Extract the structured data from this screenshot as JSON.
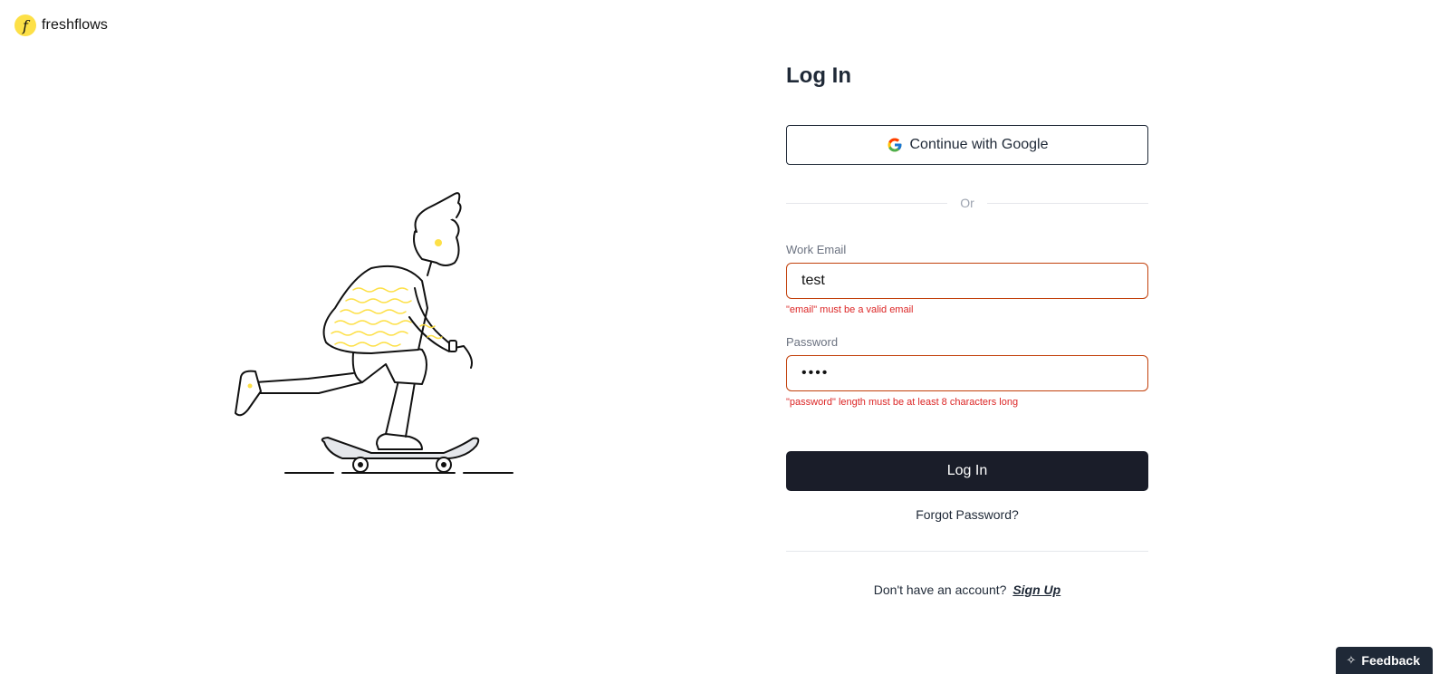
{
  "brand": {
    "logo_letter": "f",
    "name": "freshflows"
  },
  "illustration": {
    "icon": "skateboarder-illustration"
  },
  "login": {
    "title": "Log In",
    "google_label": "Continue with Google",
    "divider_label": "Or",
    "email": {
      "label": "Work Email",
      "value": "test",
      "error": "\"email\" must be a valid email"
    },
    "password": {
      "label": "Password",
      "masked_value": "••••",
      "error": "\"password\" length must be at least 8 characters long"
    },
    "submit_label": "Log In",
    "forgot_label": "Forgot Password?",
    "signup_prompt": "Don't have an account?",
    "signup_label": "Sign Up"
  },
  "feedback": {
    "label": "Feedback",
    "icon": "sparkle-icon"
  },
  "colors": {
    "accent_yellow": "#fde047",
    "error_red": "#dc2626",
    "input_border_error": "#c2410c",
    "primary_button": "#1a1d29"
  }
}
